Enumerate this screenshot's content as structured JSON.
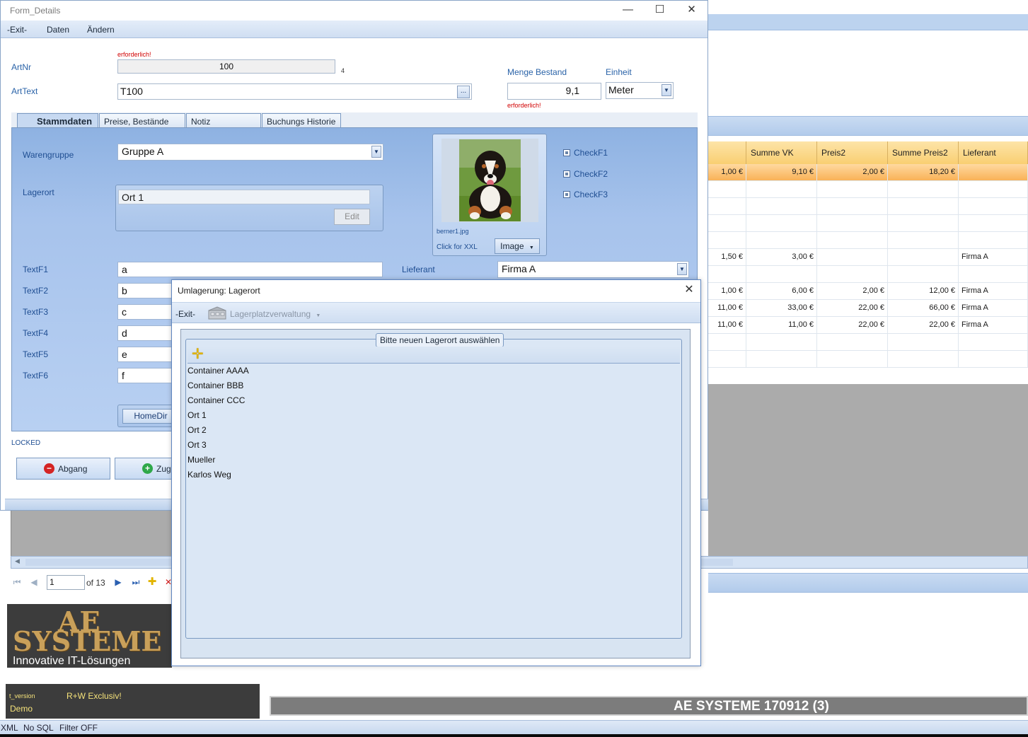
{
  "form": {
    "title": "Form_Details",
    "window_controls": {
      "minimize": "—",
      "maximize": "☐",
      "close": "✕"
    },
    "menu": [
      "-Exit-",
      "Daten",
      "Ändern"
    ],
    "artnr": {
      "label": "ArtNr",
      "required": "erforderlich!",
      "value": "100",
      "counter": "4"
    },
    "arttext": {
      "label": "ArtText",
      "value": "T100",
      "button": "..."
    },
    "menge": {
      "label": "Menge Bestand",
      "value": "9,1",
      "required": "erforderlich!"
    },
    "einheit": {
      "label": "Einheit",
      "value": "Meter"
    },
    "tabs": [
      "Stammdaten",
      "Preise, Bestände etc",
      "Notiz Bemerkung",
      "Buchungs Historie"
    ],
    "warengruppe": {
      "label": "Warengruppe",
      "value": "Gruppe A"
    },
    "lagerort": {
      "label": "Lagerort",
      "value": "Ort 1",
      "edit_button": "Edit"
    },
    "image": {
      "filename": "berner1.jpg",
      "hint": "Click for XXL",
      "button": "Image"
    },
    "checks": [
      "CheckF1",
      "CheckF2",
      "CheckF3"
    ],
    "text_fields": [
      {
        "label": "TextF1",
        "value": "a"
      },
      {
        "label": "TextF2",
        "value": "b"
      },
      {
        "label": "TextF3",
        "value": "c"
      },
      {
        "label": "TextF4",
        "value": "d"
      },
      {
        "label": "TextF5",
        "value": "e"
      },
      {
        "label": "TextF6",
        "value": "f"
      }
    ],
    "lieferant": {
      "label": "Lieferant",
      "value": "Firma A"
    },
    "homedir_button": "HomeDir",
    "locked": "LOCKED",
    "abgang_button": "Abgang",
    "zugang_button": "Zugang"
  },
  "dialog": {
    "title": "Umlagerung: Lagerort",
    "close": "✕",
    "exit": "-Exit-",
    "lagerplatz": "Lagerplatzverwaltung",
    "group_title": "Bitte neuen Lagerort auswählen",
    "locations": [
      "Container AAAA",
      "Container BBB",
      "Container CCC",
      "Ort 1",
      "Ort 2",
      "Ort 3",
      "Mueller",
      "Karlos Weg"
    ]
  },
  "grid": {
    "headers": [
      "Summe VK",
      "Preis2",
      "Summe Preis2",
      "Lieferant"
    ],
    "rows": [
      {
        "selected": true,
        "c0": "1,00 €",
        "c1": "9,10 €",
        "c2": "2,00 €",
        "c3": "18,20 €",
        "c4": ""
      },
      {
        "c0": "",
        "c1": "",
        "c2": "",
        "c3": "",
        "c4": ""
      },
      {
        "c0": "",
        "c1": "",
        "c2": "",
        "c3": "",
        "c4": ""
      },
      {
        "c0": "",
        "c1": "",
        "c2": "",
        "c3": "",
        "c4": ""
      },
      {
        "c0": "",
        "c1": "",
        "c2": "",
        "c3": "",
        "c4": ""
      },
      {
        "c0": "1,50 €",
        "c1": "3,00 €",
        "c2": "",
        "c3": "",
        "c4": "Firma A"
      },
      {
        "c0": "",
        "c1": "",
        "c2": "",
        "c3": "",
        "c4": ""
      },
      {
        "c0": "1,00 €",
        "c1": "6,00 €",
        "c2": "2,00 €",
        "c3": "12,00 €",
        "c4": "Firma A"
      },
      {
        "c0": "11,00 €",
        "c1": "33,00 €",
        "c2": "22,00 €",
        "c3": "66,00 €",
        "c4": "Firma A"
      },
      {
        "c0": "11,00 €",
        "c1": "11,00 €",
        "c2": "22,00 €",
        "c3": "22,00 €",
        "c4": "Firma A"
      },
      {
        "c0": "",
        "c1": "",
        "c2": "",
        "c3": "",
        "c4": ""
      },
      {
        "c0": "",
        "c1": "",
        "c2": "",
        "c3": "",
        "c4": ""
      }
    ]
  },
  "navigator": {
    "page": "1",
    "of": "of 13"
  },
  "logo": {
    "line1": "AE",
    "line2": "SYSTEME",
    "tagline": "Innovative IT-Lösungen"
  },
  "version": {
    "key": "t_version",
    "value": "Demo",
    "rights": "R+W Exclusiv!"
  },
  "banner": "AE SYSTEME 170912 (3)",
  "statusbar": {
    "xml": "XML",
    "sql": "No SQL",
    "filter": "Filter OFF"
  },
  "colors": {
    "accent": "#2a63a8",
    "required": "#d10000",
    "panel": "#a7c3ec",
    "selected_row": "#f9b257"
  }
}
